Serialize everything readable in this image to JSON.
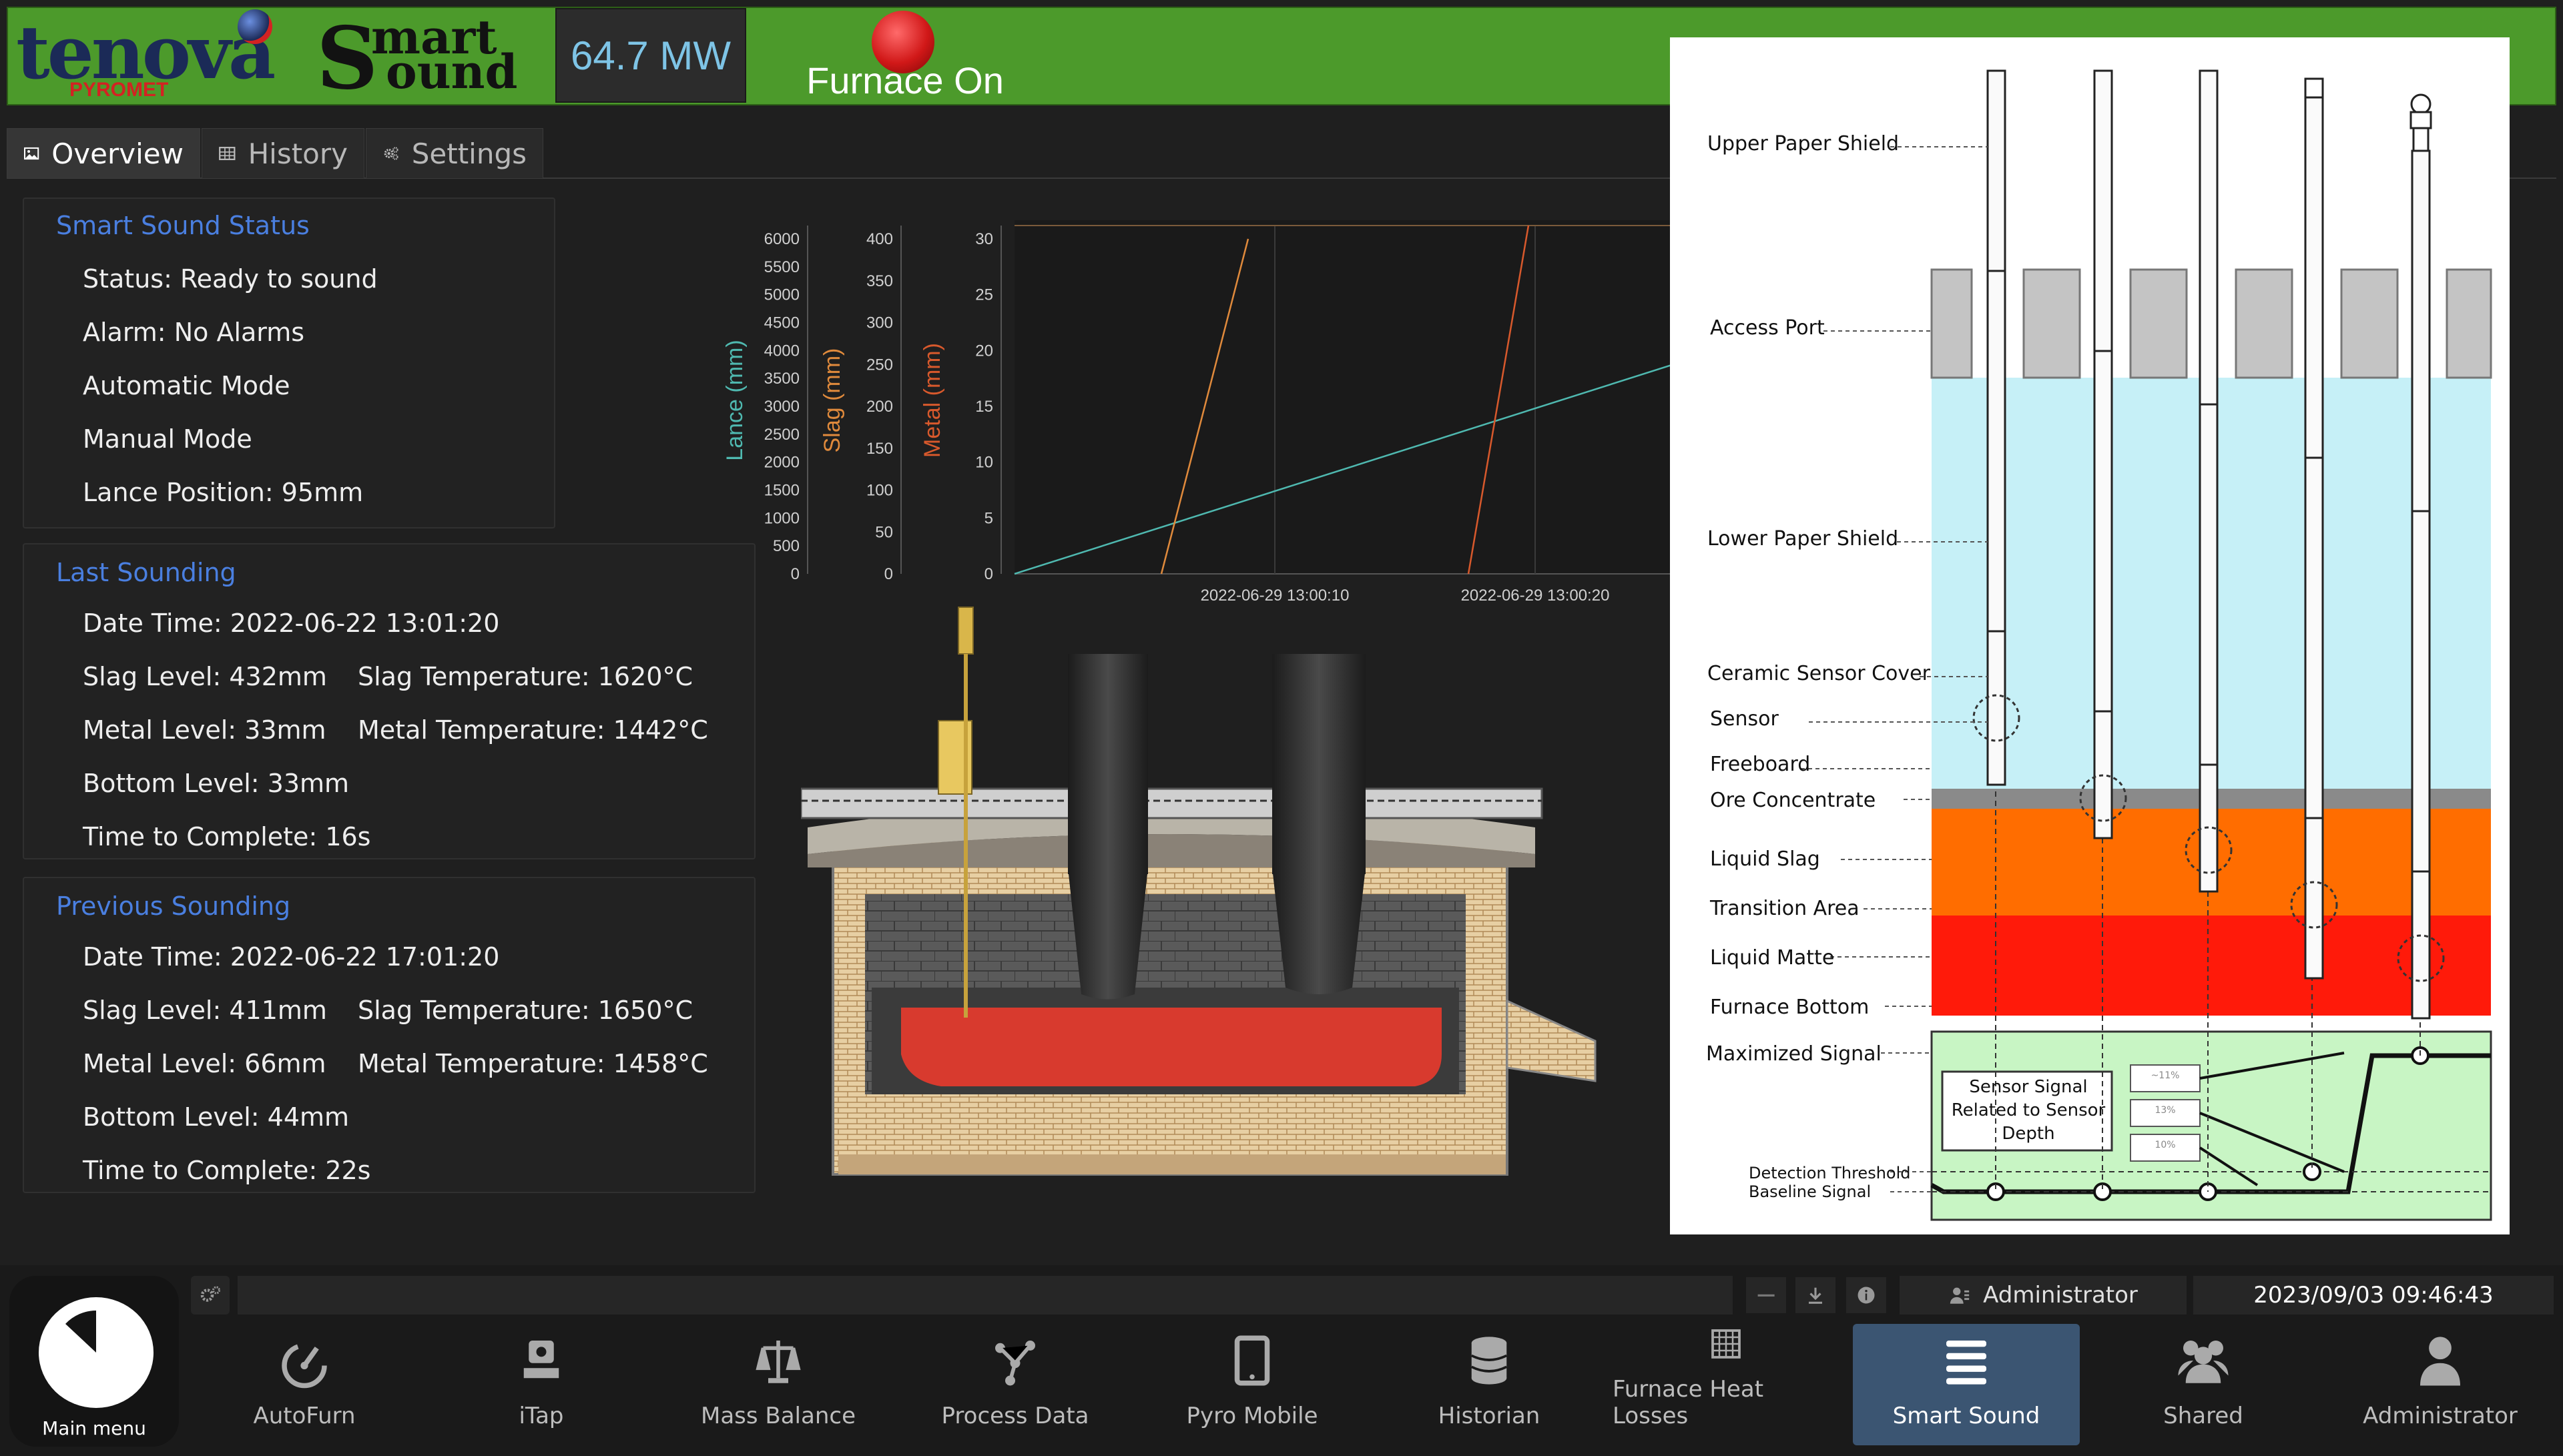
{
  "header": {
    "logo_text": "tenova",
    "logo_sub": "PYROMET",
    "product_logo_top": "mart",
    "product_logo_bottom": "ound",
    "product_logo_initial": "S",
    "power": "64.7 MW",
    "furnace_status": "Furnace On",
    "status_color": "#d11818"
  },
  "tabs": [
    {
      "label": "Overview",
      "icon": "image-icon",
      "active": true
    },
    {
      "label": "History",
      "icon": "table-icon",
      "active": false
    },
    {
      "label": "Settings",
      "icon": "gears-icon",
      "active": false
    }
  ],
  "status_panel": {
    "title": "Smart Sound Status",
    "rows": [
      "Status: Ready to sound",
      "Alarm: No Alarms",
      "Automatic Mode",
      "Manual Mode",
      "Lance Position: 95mm"
    ]
  },
  "last_sounding": {
    "title": "Last Sounding",
    "date_time": "Date Time: 2022-06-22 13:01:20",
    "slag_level": "Slag Level: 432mm",
    "slag_temp": "Slag Temperature: 1620°C",
    "metal_level": "Metal Level: 33mm",
    "metal_temp": "Metal Temperature: 1442°C",
    "bottom_level": "Bottom Level: 33mm",
    "time_to_complete": "Time to Complete: 16s"
  },
  "previous_sounding": {
    "title": "Previous Sounding",
    "date_time": "Date Time: 2022-06-22 17:01:20",
    "slag_level": "Slag Level: 411mm",
    "slag_temp": "Slag Temperature: 1650°C",
    "metal_level": "Metal Level: 66mm",
    "metal_temp": "Metal Temperature: 1458°C",
    "bottom_level": "Bottom Level: 44mm",
    "time_to_complete": "Time to Complete: 22s"
  },
  "chart_data": {
    "type": "line",
    "axes": [
      {
        "label": "Lance (mm)",
        "color": "#4fb9b0",
        "ticks": [
          "0",
          "500",
          "1000",
          "1500",
          "2000",
          "2500",
          "3000",
          "3500",
          "4000",
          "4500",
          "5000",
          "5500",
          "6000"
        ],
        "ylim": [
          0,
          6000
        ]
      },
      {
        "label": "Slag (mm)",
        "color": "#e08a3c",
        "ticks": [
          "0",
          "50",
          "100",
          "150",
          "200",
          "250",
          "300",
          "350",
          "400"
        ],
        "ylim": [
          0,
          400
        ]
      },
      {
        "label": "Metal (mm)",
        "color": "#d8592c",
        "ticks": [
          "0",
          "5",
          "10",
          "15",
          "20",
          "25",
          "30"
        ],
        "ylim": [
          0,
          30
        ]
      }
    ],
    "x_ticks": [
      "2022-06-29 13:00:10",
      "2022-06-29 13:00:20"
    ],
    "series": [
      {
        "axis": "Lance (mm)",
        "color": "#4fb9b0",
        "x": [
          0.0,
          1.0
        ],
        "y": [
          0,
          3800
        ]
      },
      {
        "axis": "Slag (mm)",
        "color": "#e08a3c",
        "x": [
          0.22,
          0.35
        ],
        "y": [
          0,
          400
        ]
      },
      {
        "axis": "Metal (mm)",
        "color": "#d8592c",
        "x": [
          0.68,
          0.77
        ],
        "y": [
          0,
          33
        ]
      }
    ]
  },
  "diagram": {
    "labels_left": [
      "Upper Paper Shield",
      "Access Port",
      "Lower Paper Shield",
      "Ceramic Sensor Cover",
      "Sensor",
      "Freeboard",
      "Ore Concentrate",
      "Liquid Slag",
      "Transition Area",
      "Liquid Matte",
      "Furnace Bottom",
      "Maximized Signal",
      "Detection Threshold",
      "Baseline Signal"
    ],
    "signal_box": "Sensor Signal Related to Sensor Depth",
    "small_values": [
      "~11%",
      "13%",
      "10%"
    ],
    "layer_colors": {
      "freeboard": "#c6f0f7",
      "ore": "#8a8a8a",
      "slag": "#ff6d00",
      "matte": "#ff1a0a",
      "signal_bg": "#c8f5c4",
      "port": "#c4c4c4"
    }
  },
  "statusbar": {
    "user": "Administrator",
    "datetime": "2023/09/03 09:46:43"
  },
  "main_menu": {
    "label": "Main menu"
  },
  "nav": [
    {
      "label": "AutoFurn",
      "icon": "gauge-icon"
    },
    {
      "label": "iTap",
      "icon": "tap-icon"
    },
    {
      "label": "Mass Balance",
      "icon": "scale-icon"
    },
    {
      "label": "Process Data",
      "icon": "network-icon"
    },
    {
      "label": "Pyro Mobile",
      "icon": "tablet-icon"
    },
    {
      "label": "Historian",
      "icon": "database-icon"
    },
    {
      "label": "Furnace Heat Losses",
      "icon": "grid-icon"
    },
    {
      "label": "Smart Sound",
      "icon": "lines-icon",
      "active": true
    },
    {
      "label": "Shared",
      "icon": "users-icon"
    },
    {
      "label": "Administrator",
      "icon": "user-icon"
    }
  ]
}
